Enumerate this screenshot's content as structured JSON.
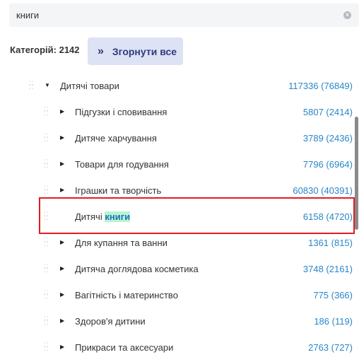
{
  "search": {
    "value": "книги"
  },
  "categories": {
    "count_label": "Категорій: 2142"
  },
  "collapse_button": {
    "label": "Згорнути все"
  },
  "tree": {
    "root": {
      "name": "Дитячі товари",
      "count": "117336 (76849)"
    },
    "children": [
      {
        "name": "Підгузки і сповивання",
        "count": "5807 (2414)"
      },
      {
        "name": "Дитяче харчування",
        "count": "3789 (2436)"
      },
      {
        "name": "Товари для годування",
        "count": "7796 (6964)"
      },
      {
        "name": "Іграшки та творчість",
        "count": "60830 (40391)"
      },
      {
        "name_prefix": "Дитячі ",
        "name_match": "книги",
        "count": "6158 (4720)",
        "highlighted": true
      },
      {
        "name": "Для купання та ванни",
        "count": "1361 (815)"
      },
      {
        "name": "Дитяча доглядова косметика",
        "count": "3748 (2161)"
      },
      {
        "name": "Вагітність і материнство",
        "count": "775 (366)"
      },
      {
        "name": "Здоров'я дитини",
        "count": "186 (119)"
      },
      {
        "name": "Прикраси та аксесуари",
        "count": "2763 (727)"
      }
    ]
  },
  "colors": {
    "count_link": "#2a86c8",
    "highlight_border": "#e11d23",
    "match_bg": "#b8f5cf",
    "button_bg": "#dde2f4"
  }
}
